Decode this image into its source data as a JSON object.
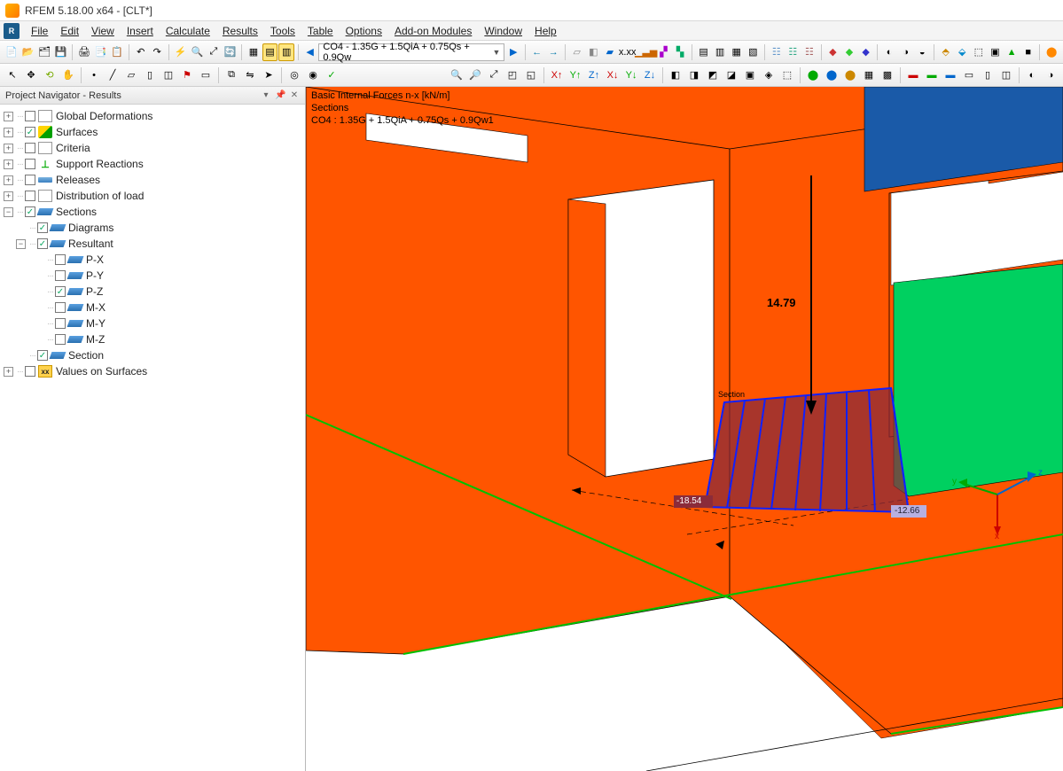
{
  "title": "RFEM 5.18.00 x64 - [CLT*]",
  "menu": [
    "File",
    "Edit",
    "View",
    "Insert",
    "Calculate",
    "Results",
    "Tools",
    "Table",
    "Options",
    "Add-on Modules",
    "Window",
    "Help"
  ],
  "combo_value": "CO4 - 1.35G + 1.5QiA + 0.75Qs + 0.9Qw",
  "navigator_title": "Project Navigator - Results",
  "tree": {
    "global_deformations": "Global Deformations",
    "surfaces": "Surfaces",
    "criteria": "Criteria",
    "support_reactions": "Support Reactions",
    "releases": "Releases",
    "distribution": "Distribution of load",
    "sections": "Sections",
    "diagrams": "Diagrams",
    "resultant": "Resultant",
    "px": "P-X",
    "py": "P-Y",
    "pz": "P-Z",
    "mx": "M-X",
    "my": "M-Y",
    "mz": "M-Z",
    "section": "Section",
    "values_on_surfaces": "Values on Surfaces"
  },
  "viewport": {
    "header_l1": "Basic Internal Forces n-x [kN/m]",
    "header_l2": "Sections",
    "header_l3": "CO4 : 1.35G + 1.5QiA + 0.75Qs + 0.9Qw1",
    "peak_value": "14.79",
    "left_value": "-18.54",
    "right_value": "-12.66",
    "section_label": "Section",
    "axis_x": "x",
    "axis_y": "y",
    "axis_z": "z"
  }
}
